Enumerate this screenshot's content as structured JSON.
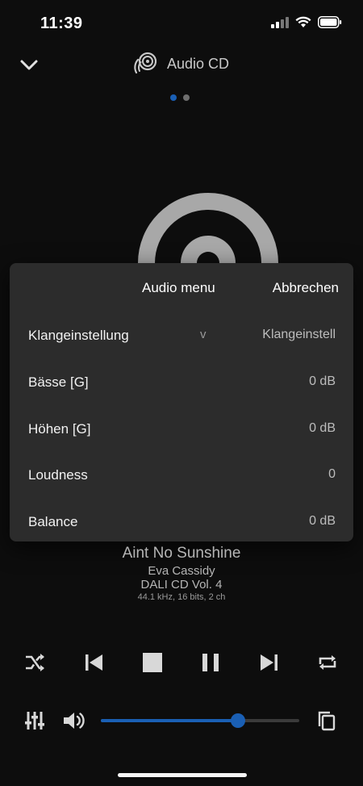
{
  "status": {
    "time": "11:39"
  },
  "header": {
    "source_label": "Audio CD",
    "page_count": 2,
    "active_page": 1
  },
  "menu": {
    "title": "Audio menu",
    "cancel_label": "Abbrechen",
    "rows": [
      {
        "label": "Klangeinstellung",
        "caret": "v",
        "value": "Klangeinstell"
      },
      {
        "label": "Bässe [G]",
        "value": "0 dB"
      },
      {
        "label": "Höhen [G]",
        "value": "0 dB"
      },
      {
        "label": "Loudness",
        "value": "0"
      },
      {
        "label": "Balance",
        "value": "0 dB"
      }
    ]
  },
  "track": {
    "title": "Aint No Sunshine",
    "artist": "Eva Cassidy",
    "album": "DALI CD Vol. 4",
    "format": "44.1 kHz, 16 bits, 2 ch"
  },
  "transport": {
    "shuffle_icon": "shuffle-icon",
    "previous_icon": "skip-previous-icon",
    "stop_icon": "stop-icon",
    "pause_icon": "pause-icon",
    "next_icon": "skip-next-icon",
    "repeat_icon": "repeat-icon"
  },
  "volume": {
    "level": 0.69
  },
  "colors": {
    "accent": "#1a5fb4",
    "menu_bg": "#2c2c2c",
    "background": "#0d0d0d"
  }
}
